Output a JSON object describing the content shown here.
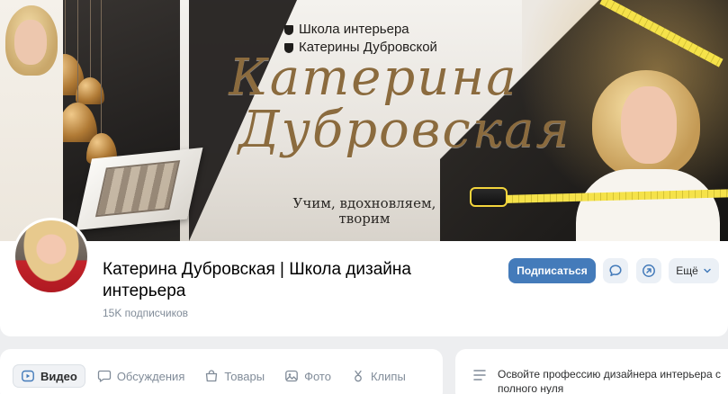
{
  "cover": {
    "school_line_1": "Школа интерьера",
    "school_line_2": "Катерины Дубровской",
    "script_line_1": "Катерина",
    "script_line_2": "Дубровская",
    "tagline_line_1": "Учим, вдохновляем,",
    "tagline_line_2": "творим"
  },
  "profile": {
    "title": "Катерина Дубровская | Школа дизайна интерьера",
    "subscribers": "15K подписчиков",
    "subscribe_label": "Подписаться",
    "more_label": "Ещё"
  },
  "tabs": [
    {
      "label": "Видео",
      "icon": "video-icon",
      "active": true
    },
    {
      "label": "Обсуждения",
      "icon": "discussions-icon",
      "active": false
    },
    {
      "label": "Товары",
      "icon": "shopping-bag-icon",
      "active": false
    },
    {
      "label": "Фото",
      "icon": "photo-icon",
      "active": false
    },
    {
      "label": "Клипы",
      "icon": "clips-icon",
      "active": false
    }
  ],
  "side": {
    "text": "Освойте профессию дизайнера интерьера с полного нуля",
    "icon": "menu-lines-icon"
  },
  "colors": {
    "accent": "#447bba",
    "secondary_button_bg": "#ebf0f6",
    "muted_text": "#818c99",
    "page_bg": "#edeef0",
    "gold_script": "#8b6b3e"
  }
}
